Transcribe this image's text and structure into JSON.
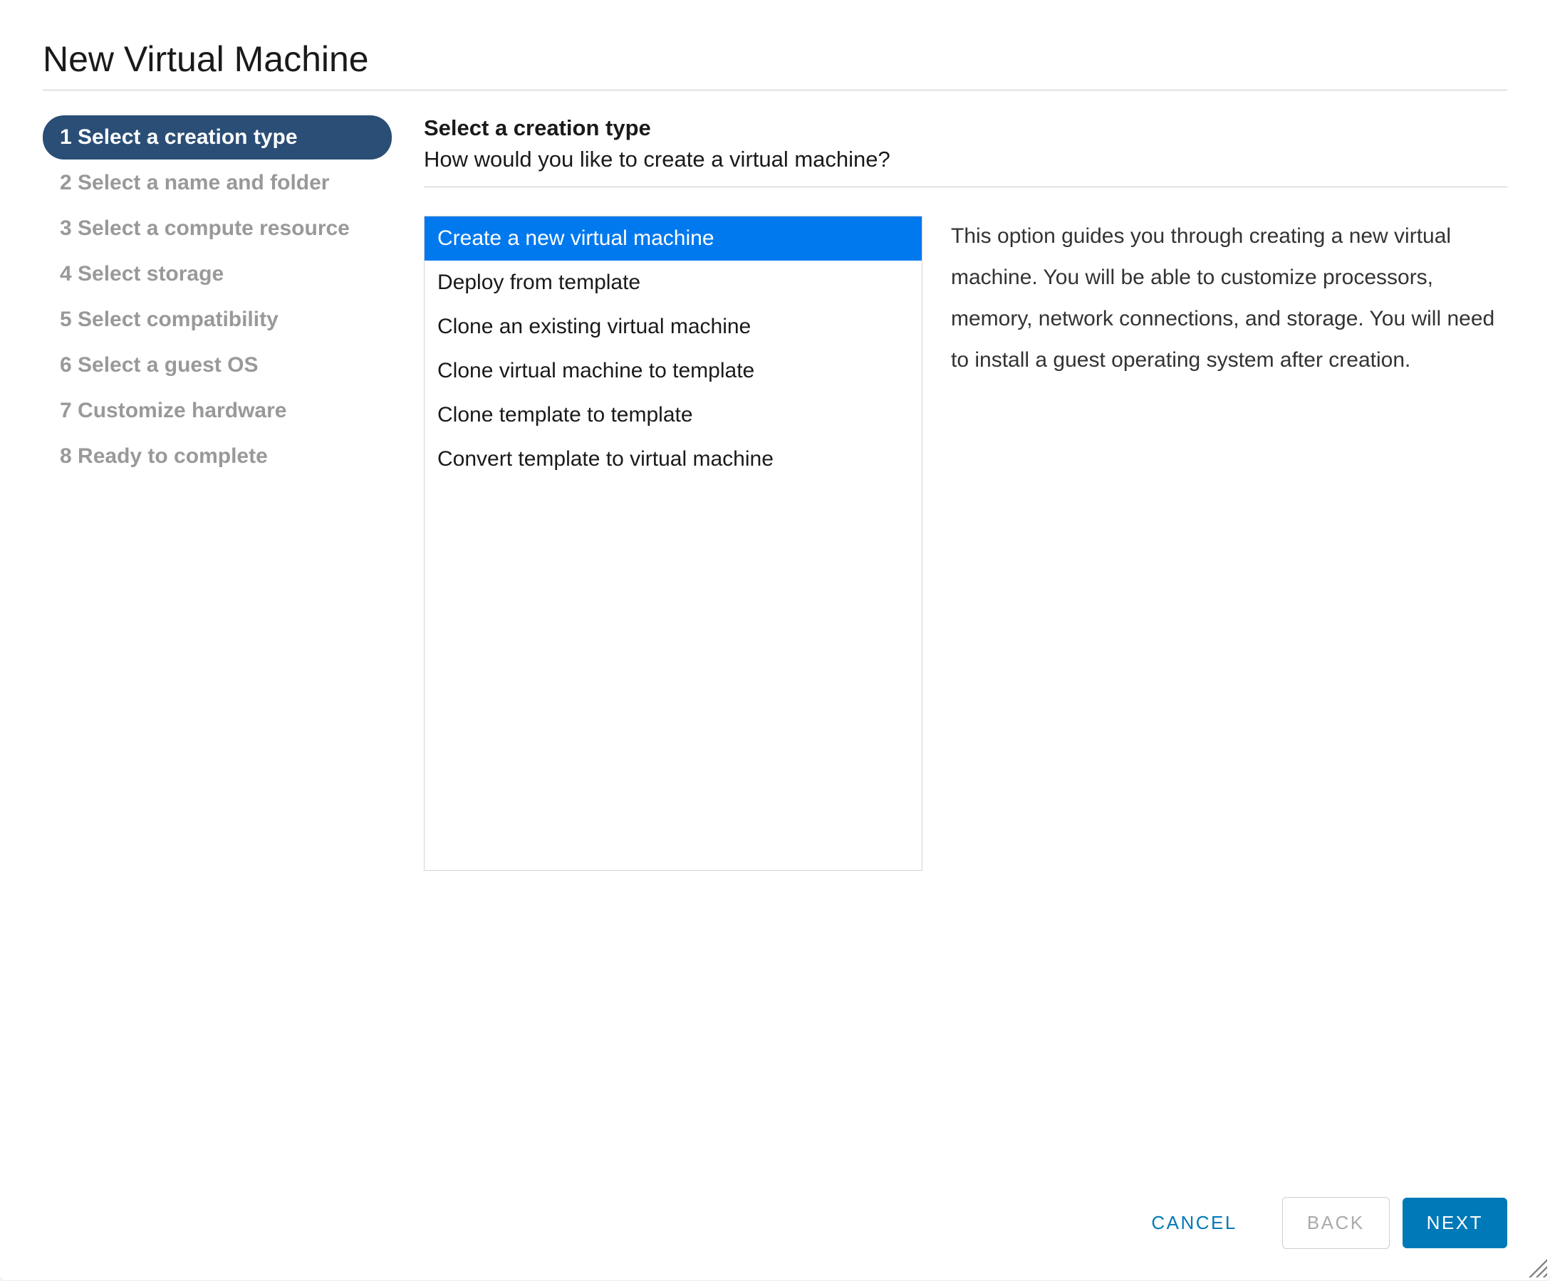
{
  "dialog": {
    "title": "New Virtual Machine"
  },
  "wizard": {
    "steps": [
      {
        "num": "1",
        "label": "Select a creation type",
        "active": true
      },
      {
        "num": "2",
        "label": "Select a name and folder",
        "active": false
      },
      {
        "num": "3",
        "label": "Select a compute resource",
        "active": false
      },
      {
        "num": "4",
        "label": "Select storage",
        "active": false
      },
      {
        "num": "5",
        "label": "Select compatibility",
        "active": false
      },
      {
        "num": "6",
        "label": "Select a guest OS",
        "active": false
      },
      {
        "num": "7",
        "label": "Customize hardware",
        "active": false
      },
      {
        "num": "8",
        "label": "Ready to complete",
        "active": false
      }
    ]
  },
  "content": {
    "title": "Select a creation type",
    "subtitle": "How would you like to create a virtual machine?",
    "options": [
      {
        "label": "Create a new virtual machine",
        "selected": true
      },
      {
        "label": "Deploy from template",
        "selected": false
      },
      {
        "label": "Clone an existing virtual machine",
        "selected": false
      },
      {
        "label": "Clone virtual machine to template",
        "selected": false
      },
      {
        "label": "Clone template to template",
        "selected": false
      },
      {
        "label": "Convert template to virtual machine",
        "selected": false
      }
    ],
    "description": "This option guides you through creating a new virtual machine. You will be able to customize processors, memory, network connections, and storage. You will need to install a guest operating system after creation."
  },
  "footer": {
    "cancel": "CANCEL",
    "back": "BACK",
    "next": "NEXT"
  }
}
